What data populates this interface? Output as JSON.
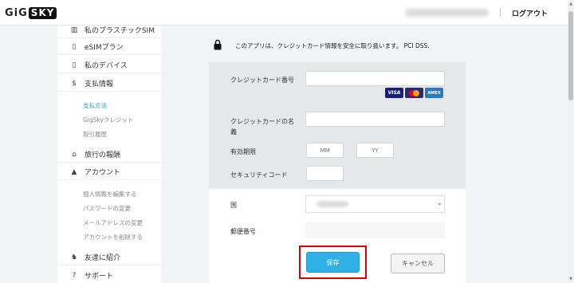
{
  "header": {
    "logo_left": "GiG",
    "logo_right": "SKY",
    "logout": "ログアウト"
  },
  "sidebar": {
    "items": [
      {
        "label": "私のプラスチックSIM",
        "icon": "sim-card-icon",
        "glyph": "▥"
      },
      {
        "label": "eSIMプラン",
        "icon": "phone-icon",
        "glyph": "▯"
      },
      {
        "label": "私のデバイス",
        "icon": "device-icon",
        "glyph": "▯"
      },
      {
        "label": "支払情報",
        "icon": "dollar-icon",
        "glyph": "$"
      },
      {
        "label": "旅行の報酬",
        "icon": "rewards-icon",
        "glyph": "⌂"
      },
      {
        "label": "アカウント",
        "icon": "user-icon",
        "glyph": "▲"
      },
      {
        "label": "友達に紹介",
        "icon": "refer-friend-icon",
        "glyph": "♞"
      },
      {
        "label": "サポート",
        "icon": "help-icon",
        "glyph": "?"
      }
    ],
    "payment_sub": [
      "支払方法",
      "GigSkyクレジット",
      "取引履歴"
    ],
    "account_sub": [
      "個人情報を編集する",
      "パスワードの変更",
      "メールアドレスの変更",
      "アカウントを削除する"
    ]
  },
  "main": {
    "secure_notice": "このアプリは、クレジットカード情報を安全に取り扱います。 PCI DSS.",
    "card_number_label": "クレジットカード番号",
    "card_name_label_1": "クレジットカードの名",
    "card_name_label_2": "義",
    "expiry_label": "有効期限",
    "expiry_month_placeholder": "MM",
    "expiry_year_placeholder": "YY",
    "security_code_label": "セキュリティコード",
    "country_label": "国",
    "zip_label": "郵便番号",
    "card_logos": {
      "visa": "VISA",
      "amex": "AMEX"
    },
    "save_button": "保存",
    "cancel_button": "キャンセル"
  },
  "colors": {
    "accent": "#2fb1e6",
    "highlight": "#e00000",
    "active_link": "#2aa4dd"
  }
}
